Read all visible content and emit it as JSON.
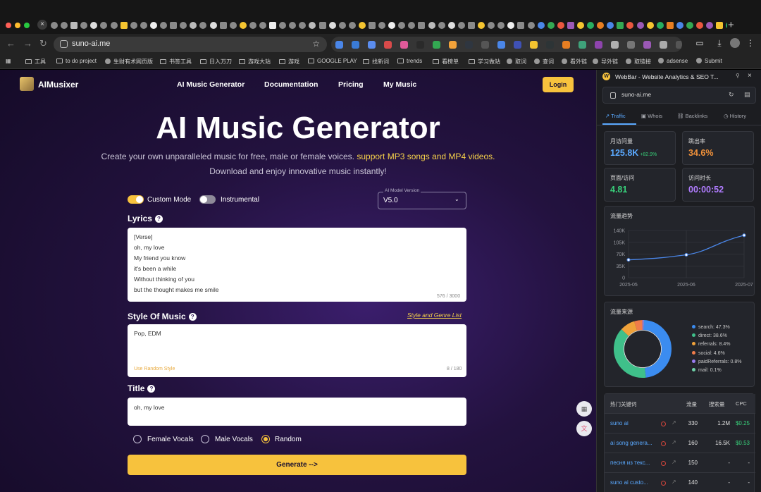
{
  "browser": {
    "url": "suno-ai.me",
    "tab_close": "×",
    "new_tab": "+",
    "bookmarks": [
      {
        "label": "工具",
        "type": "folder"
      },
      {
        "label": "to do project",
        "type": "folder"
      },
      {
        "label": "生财有术网页版",
        "type": "site"
      },
      {
        "label": "书签工具",
        "type": "folder"
      },
      {
        "label": "日入万刀",
        "type": "folder"
      },
      {
        "label": "游戏大站",
        "type": "folder"
      },
      {
        "label": "游戏",
        "type": "folder"
      },
      {
        "label": "GOOGLE PLAY",
        "type": "folder"
      },
      {
        "label": "找新词",
        "type": "folder"
      },
      {
        "label": "trends",
        "type": "folder"
      },
      {
        "label": "看榜单",
        "type": "folder"
      },
      {
        "label": "学习做站",
        "type": "folder"
      },
      {
        "label": "取词",
        "type": "site"
      },
      {
        "label": "查词",
        "type": "site"
      },
      {
        "label": "看外链",
        "type": "site"
      },
      {
        "label": "导外链",
        "type": "site"
      },
      {
        "label": "取链接",
        "type": "site"
      },
      {
        "label": "adsense",
        "type": "site"
      },
      {
        "label": "Submit",
        "type": "site"
      }
    ]
  },
  "site": {
    "brand": "AIMusixer",
    "nav": [
      "AI Music Generator",
      "Documentation",
      "Pricing",
      "My Music"
    ],
    "login": "Login",
    "hero_title": "AI Music Generator",
    "hero_sub_plain": "Create your own unparalleled music for free, male or female voices.",
    "hero_sub_highlight": "support MP3 songs and MP4 videos.",
    "hero_sub2": "Download and enjoy innovative music instantly!",
    "custom_mode": "Custom Mode",
    "instrumental": "Instrumental",
    "model_legend": "AI Model Version",
    "model_value": "V5.0",
    "lyrics_label": "Lyrics",
    "lyrics_lines": [
      "[Verse]",
      "oh, my love",
      "My friend you know",
      "it's been a while",
      "Without thinking of you",
      "but the thought makes me smile"
    ],
    "lyrics_counter": "576 / 3000",
    "style_label": "Style Of Music",
    "style_link": "Style and Genre List",
    "style_value": "Pop, EDM",
    "style_random": "Use Random Style",
    "style_counter": "8 / 180",
    "title_label": "Title",
    "title_value": "oh, my love",
    "vocals": [
      "Female Vocals",
      "Male Vocals",
      "Random"
    ],
    "vocals_selected": "Random",
    "generate": "Generate -->"
  },
  "webbar": {
    "title": "WebBar - Website Analytics & SEO T...",
    "domain": "suno-ai.me",
    "tabs": [
      "Traffic",
      "Whois",
      "Backlinks",
      "History"
    ],
    "kpis": [
      {
        "label": "月访问量",
        "value": "125.8K",
        "delta": "+82.9%",
        "color": "#5aa9ff"
      },
      {
        "label": "跳出率",
        "value": "34.6%",
        "delta": "",
        "color": "#f0913a"
      },
      {
        "label": "页面/访问",
        "value": "4.81",
        "delta": "",
        "color": "#38d07a"
      },
      {
        "label": "访问时长",
        "value": "00:00:52",
        "delta": "",
        "color": "#b07cff"
      }
    ],
    "trend_title": "流量趋势",
    "sources_title": "流量来源",
    "keywords": {
      "headers": [
        "热门关键词",
        "流量",
        "搜索量",
        "CPC"
      ],
      "rows": [
        {
          "term": "suno ai",
          "traffic": "330",
          "volume": "1.2M",
          "cpc": "$0.25"
        },
        {
          "term": "ai song genera...",
          "traffic": "160",
          "volume": "16.5K",
          "cpc": "$0.53"
        },
        {
          "term": "песня из текс...",
          "traffic": "150",
          "volume": "-",
          "cpc": "-"
        },
        {
          "term": "suno ai custo...",
          "traffic": "140",
          "volume": "-",
          "cpc": "-"
        }
      ]
    }
  },
  "chart_data": [
    {
      "type": "line",
      "title": "流量趋势",
      "x": [
        "2025-05",
        "2025-06",
        "2025-07"
      ],
      "series": [
        {
          "values": [
            53000,
            68000,
            125800
          ]
        }
      ],
      "ylim": [
        0,
        140000
      ],
      "yticks": [
        "0",
        "35K",
        "70K",
        "105K",
        "140K"
      ],
      "grid": true
    },
    {
      "type": "pie",
      "title": "流量来源",
      "legend": "right",
      "slices": [
        {
          "label": "search: 47.3%",
          "value": 47.3,
          "color": "#3b8cf0"
        },
        {
          "label": "direct: 38.6%",
          "value": 38.6,
          "color": "#3fc08a"
        },
        {
          "label": "referrals: 8.4%",
          "value": 8.4,
          "color": "#f0a23a"
        },
        {
          "label": "social: 4.6%",
          "value": 4.6,
          "color": "#f07c4a"
        },
        {
          "label": "paidReferrals: 0.8%",
          "value": 0.8,
          "color": "#9a7cf0"
        },
        {
          "label": "mail: 0.1%",
          "value": 0.1,
          "color": "#6fd0a8"
        }
      ]
    }
  ]
}
